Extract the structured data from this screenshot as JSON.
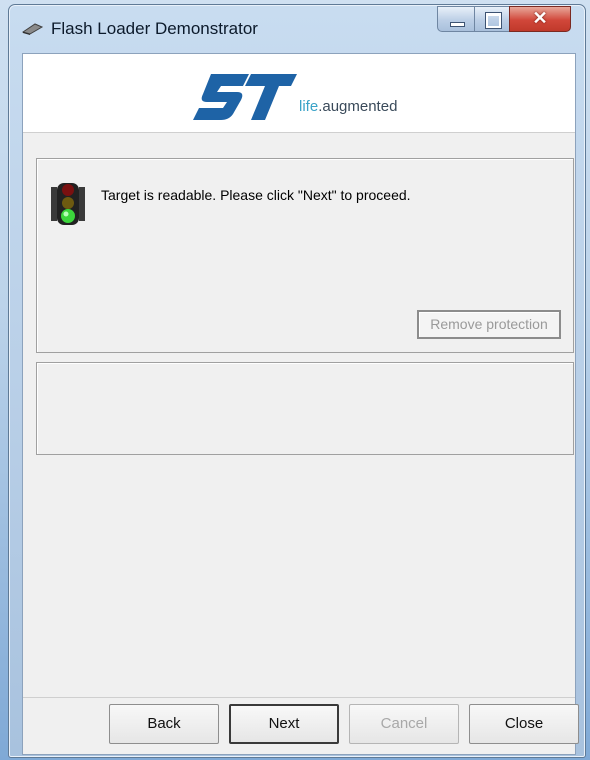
{
  "window": {
    "title": "Flash Loader Demonstrator",
    "controls": {
      "minimize": "minimize",
      "maximize": "maximize",
      "close": "✕"
    }
  },
  "logo": {
    "brand": "ST",
    "tagline_life": "life",
    "tagline_rest": ".augmented",
    "brand_color": "#1e63a6",
    "accent_color": "#3aa3c8"
  },
  "status": {
    "icon": "traffic-light-icon",
    "active_light": "green",
    "message": "Target is readable. Please click \"Next\" to proceed."
  },
  "remove_protection": {
    "label": "Remove protection",
    "enabled": false
  },
  "buttons": {
    "back": "Back",
    "next": "Next",
    "cancel": "Cancel",
    "close": "Close"
  }
}
